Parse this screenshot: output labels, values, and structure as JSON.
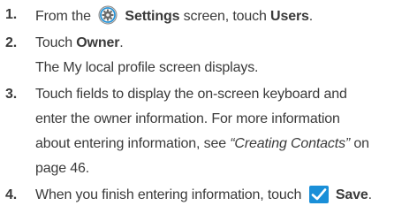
{
  "steps": [
    {
      "num": "1.",
      "pre": "From the",
      "settings_icon": "settings-gear-icon",
      "settings_label": "Settings",
      "mid": "screen, touch",
      "users_label": "Users",
      "post": "."
    },
    {
      "num": "2.",
      "pre": "Touch",
      "owner_label": "Owner",
      "post": ".",
      "note": "The My local profile screen displays."
    },
    {
      "num": "3.",
      "line1": "Touch fields to display the on-screen keyboard and",
      "line2": "enter the owner information. For more information",
      "line3_pre": "about entering information, see",
      "link_text": "“Creating Contacts”",
      "line3_post": "on",
      "line4": "page 46."
    },
    {
      "num": "4.",
      "pre": "When you finish entering information, touch",
      "save_icon": "checkmark-icon",
      "save_label": "Save",
      "post": "."
    }
  ],
  "colors": {
    "text": "#3a3a3a",
    "save_icon_bg": "#1a8fd8",
    "gear_ring": "#1a8fd8"
  }
}
